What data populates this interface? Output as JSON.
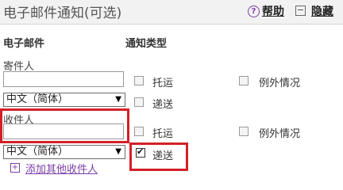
{
  "header": {
    "title": "电子邮件通知(可选)",
    "help_icon": "question-circle-icon",
    "help_label": "帮助",
    "hide_icon": "minus-square-icon",
    "hide_label": "隐藏"
  },
  "columns": {
    "email": "电子邮件",
    "notify_type": "通知类型"
  },
  "sender": {
    "label": "寄件人",
    "value": "",
    "language": "中文（简体）",
    "options": {
      "shipment": "托运",
      "delivery": "递送",
      "exception": "例外情况"
    },
    "checked": {
      "shipment": false,
      "delivery": false,
      "exception": false
    }
  },
  "recipient": {
    "label": "收件人",
    "value": "",
    "language": "中文（简体）",
    "options": {
      "shipment": "托运",
      "delivery": "递送",
      "exception": "例外情况"
    },
    "checked": {
      "shipment": false,
      "delivery": true,
      "exception": false
    }
  },
  "add_recipient": {
    "icon": "plus-square-icon",
    "label": "添加其他收件人"
  },
  "colors": {
    "highlight": "#d32027",
    "link": "#7b3fa6"
  }
}
